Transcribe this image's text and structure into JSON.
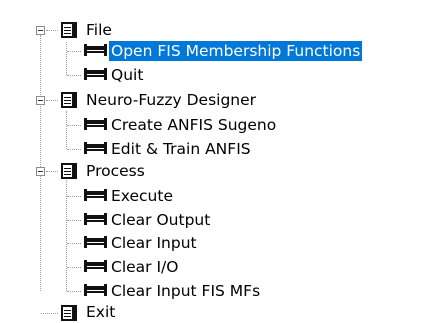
{
  "tree": {
    "nodes": [
      {
        "label": "File",
        "type": "menu",
        "expanded": true
      },
      {
        "label": "Open FIS Membership Functions",
        "type": "command",
        "selected": true
      },
      {
        "label": "Quit",
        "type": "command"
      },
      {
        "label": "Neuro-Fuzzy Designer",
        "type": "menu",
        "expanded": true
      },
      {
        "label": "Create ANFIS Sugeno",
        "type": "command"
      },
      {
        "label": "Edit & Train ANFIS",
        "type": "command"
      },
      {
        "label": "Process",
        "type": "menu",
        "expanded": true
      },
      {
        "label": "Execute",
        "type": "command"
      },
      {
        "label": "Clear Output",
        "type": "command"
      },
      {
        "label": "Clear Input",
        "type": "command"
      },
      {
        "label": "Clear I/O",
        "type": "command"
      },
      {
        "label": "Clear Input FIS MFs",
        "type": "command"
      },
      {
        "label": "Exit",
        "type": "menu"
      }
    ]
  },
  "colors": {
    "selection_bg": "#0078d7",
    "selection_text": "#ffffff",
    "connector": "#a0a0a0"
  },
  "icons": {
    "menu": "document-icon",
    "command": "command-icon",
    "toggle": "collapse-icon"
  }
}
